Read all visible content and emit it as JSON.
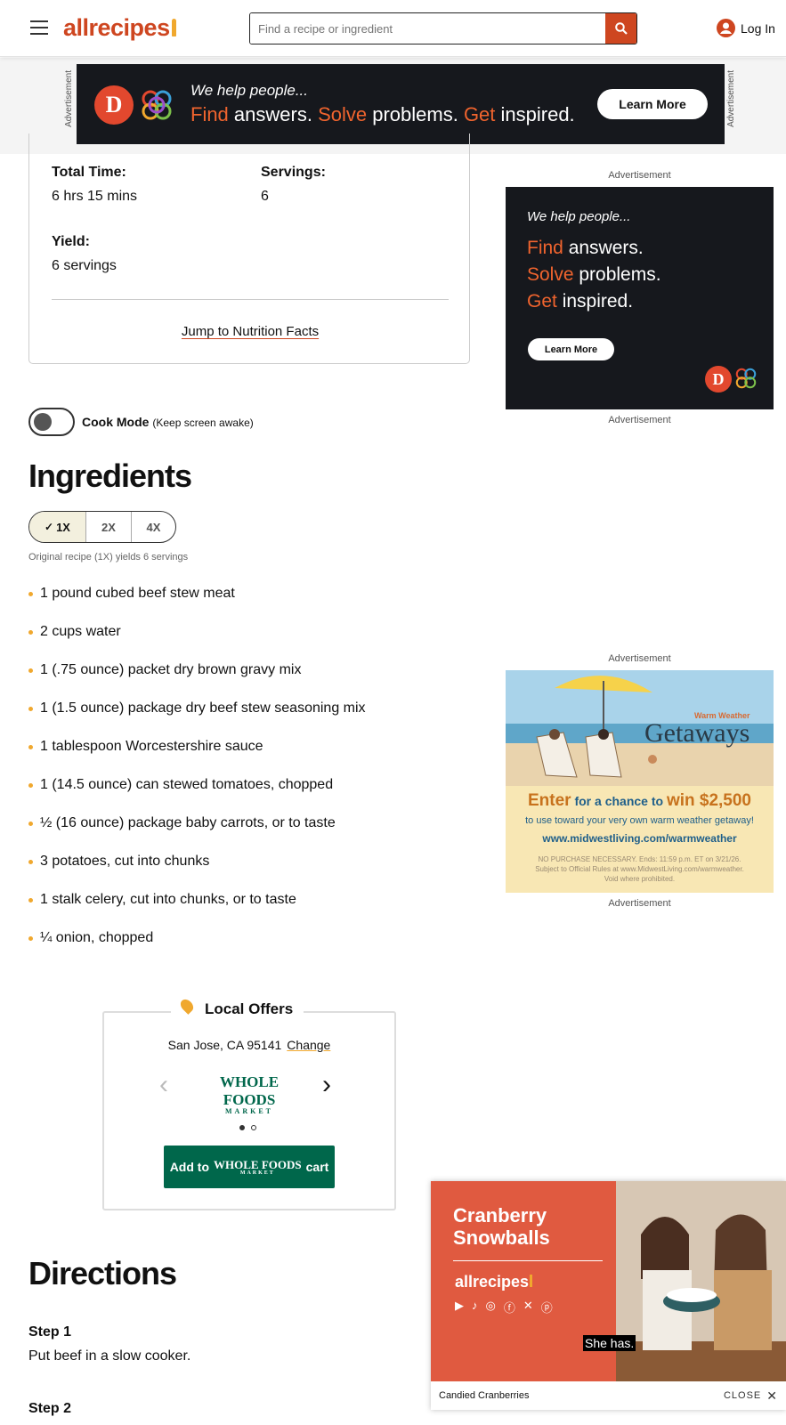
{
  "header": {
    "logo": "allrecipes",
    "search_placeholder": "Find a recipe or ingredient",
    "login": "Log In"
  },
  "top_ad": {
    "label": "Advertisement",
    "tagline": "We help people...",
    "line_parts": [
      "Find",
      " answers. ",
      "Solve",
      " problems. ",
      "Get",
      " inspired."
    ],
    "cta": "Learn More"
  },
  "recipe_info": {
    "total_time_label": "Total Time:",
    "total_time": "6 hrs 15 mins",
    "servings_label": "Servings:",
    "servings": "6",
    "yield_label": "Yield:",
    "yield": "6 servings",
    "jump_link": "Jump to Nutrition Facts"
  },
  "side_ad_1": {
    "label_top": "Advertisement",
    "label_bottom": "Advertisement",
    "tagline": "We help people...",
    "lines": [
      [
        "Find",
        " answers."
      ],
      [
        "Solve",
        " problems."
      ],
      [
        "Get",
        " inspired."
      ]
    ],
    "cta": "Learn More"
  },
  "cook_mode": {
    "label": "Cook Mode",
    "note": "(Keep screen awake)",
    "enabled": false
  },
  "ingredients": {
    "heading": "Ingredients",
    "scale_options": [
      "1X",
      "2X",
      "4X"
    ],
    "scale_selected": "1X",
    "yields_note": "Original recipe (1X) yields 6 servings",
    "items": [
      "1 pound cubed beef stew meat",
      "2 cups water",
      "1 (.75 ounce) packet dry brown gravy mix",
      "1 (1.5 ounce) package dry beef stew seasoning mix",
      "1 tablespoon Worcestershire sauce",
      "1 (14.5 ounce) can stewed tomatoes, chopped",
      "½ (16 ounce) package baby carrots, or to taste",
      "3 potatoes, cut into chunks",
      "1 stalk celery, cut into chunks, or to taste",
      "¼ onion, chopped"
    ]
  },
  "side_ad_2": {
    "label_top": "Advertisement",
    "label_bottom": "Advertisement",
    "small_title": "Warm Weather",
    "title": "Getaways",
    "enter_parts": [
      "Enter",
      " for a chance to ",
      "win $2,500"
    ],
    "sub": "to use toward your very own warm weather getaway!",
    "url": "www.midwestliving.com/warmweather",
    "fine1": "NO PURCHASE NECESSARY. Ends: 11:59 p.m. ET on 3/21/26.",
    "fine2": "Subject to Official Rules at www.MidwestLiving.com/warmweather.",
    "fine3": "Void where prohibited."
  },
  "local_offers": {
    "title": "Local Offers",
    "location": "San Jose, CA 95141",
    "change": "Change",
    "store_name": "WHOLE FOODS",
    "store_sub": "MARKET",
    "cart_prefix": "Add to",
    "cart_suffix": "cart",
    "page": 1,
    "pages": 2
  },
  "directions": {
    "heading": "Directions",
    "steps": [
      {
        "label": "Step 1",
        "text": "Put beef in a slow cooker."
      },
      {
        "label": "Step 2",
        "text": ""
      }
    ]
  },
  "video": {
    "title_line1": "Cranberry",
    "title_line2": "Snowballs",
    "brand": "allrecipes",
    "caption": "She has.",
    "footer_title": "Candied Cranberries",
    "close": "CLOSE",
    "social_icons": [
      "youtube-icon",
      "tiktok-icon",
      "instagram-icon",
      "facebook-icon",
      "x-icon",
      "pinterest-icon"
    ]
  },
  "colors": {
    "brand": "#ce4620",
    "accent": "#f0a82e",
    "ad_orange": "#f0642e",
    "whole_foods_green": "#00674b"
  }
}
